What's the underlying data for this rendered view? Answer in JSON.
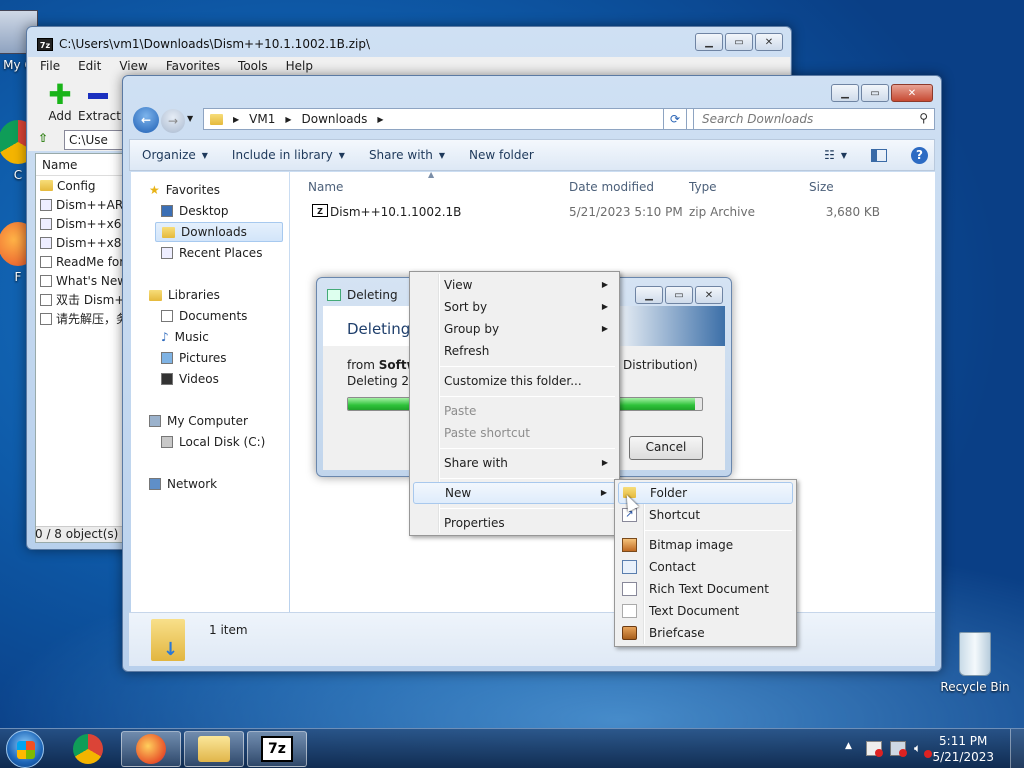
{
  "desktop": {
    "icons": [
      {
        "label": "My C"
      },
      {
        "label": "C"
      },
      {
        "label": "F"
      },
      {
        "label": "Recycle Bin"
      }
    ]
  },
  "zip_window": {
    "title": "C:\\Users\\vm1\\Downloads\\Dism++10.1.1002.1B.zip\\",
    "menu": [
      "File",
      "Edit",
      "View",
      "Favorites",
      "Tools",
      "Help"
    ],
    "toolbar": {
      "add": "Add",
      "extract": "Extract"
    },
    "path": "C:\\Use",
    "column_name": "Name",
    "items": [
      "Config",
      "Dism++ARM",
      "Dism++x64.",
      "Dism++x86.",
      "ReadMe for",
      "What's New",
      "双击 Dism++",
      "请先解压，务"
    ],
    "status": "0 / 8 object(s) se"
  },
  "explorer": {
    "breadcrumb": [
      "VM1",
      "Downloads"
    ],
    "search_placeholder": "Search Downloads",
    "toolbar": {
      "organize": "Organize",
      "include": "Include in library",
      "share": "Share with",
      "new_folder": "New folder"
    },
    "nav": {
      "favorites": "Favorites",
      "desktop": "Desktop",
      "downloads": "Downloads",
      "recent": "Recent Places",
      "libraries": "Libraries",
      "documents": "Documents",
      "music": "Music",
      "pictures": "Pictures",
      "videos": "Videos",
      "computer": "My Computer",
      "local_disk": "Local Disk (C:)",
      "network": "Network"
    },
    "columns": {
      "name": "Name",
      "date": "Date modified",
      "type": "Type",
      "size": "Size"
    },
    "file": {
      "name": "Dism++10.1.1002.1B",
      "date": "5/21/2023 5:10 PM",
      "type": "zip Archive",
      "size": "3,680 KB"
    },
    "details": "1 item"
  },
  "delete_dialog": {
    "title": "Deleting",
    "heading": "Deleting .",
    "from_prefix": "from ",
    "from_bold": "Softw",
    "from_suffix": "Distribution)",
    "line2": "Deleting 255",
    "progress": 0.98,
    "cancel": "Cancel"
  },
  "context_menu": {
    "view": "View",
    "sort_by": "Sort by",
    "group_by": "Group by",
    "refresh": "Refresh",
    "customize": "Customize this folder...",
    "paste": "Paste",
    "paste_shortcut": "Paste shortcut",
    "share_with": "Share with",
    "new": "New",
    "properties": "Properties"
  },
  "new_submenu": {
    "folder": "Folder",
    "shortcut": "Shortcut",
    "bitmap": "Bitmap image",
    "contact": "Contact",
    "rtf": "Rich Text Document",
    "text": "Text Document",
    "briefcase": "Briefcase"
  },
  "taskbar": {
    "zip_label": "7z",
    "time": "5:11 PM",
    "date": "5/21/2023"
  }
}
